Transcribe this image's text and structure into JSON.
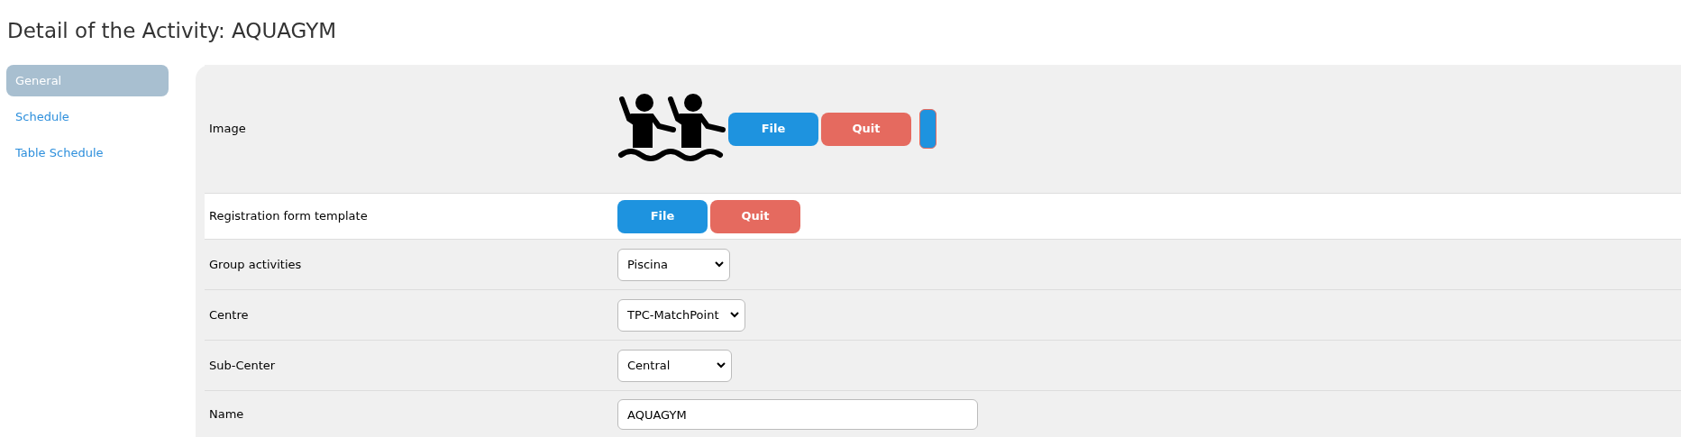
{
  "title": "Detail of the Activity: AQUAGYM",
  "sidebar": {
    "items": [
      {
        "label": "General",
        "selected": true
      },
      {
        "label": "Schedule",
        "selected": false
      },
      {
        "label": "Table Schedule",
        "selected": false
      }
    ]
  },
  "form": {
    "rows": [
      {
        "kind": "image",
        "label": "Image",
        "buttons": [
          "File",
          "Quit"
        ]
      },
      {
        "kind": "file",
        "label": "Registration form template",
        "buttons": [
          "File",
          "Quit"
        ]
      },
      {
        "kind": "select",
        "label": "Group activities",
        "value": "Piscina"
      },
      {
        "kind": "select",
        "label": "Centre",
        "value": "TPC-MatchPoint"
      },
      {
        "kind": "select",
        "label": "Sub-Center",
        "value": "Central"
      },
      {
        "kind": "text",
        "label": "Name",
        "value": "AQUAGYM"
      }
    ]
  }
}
